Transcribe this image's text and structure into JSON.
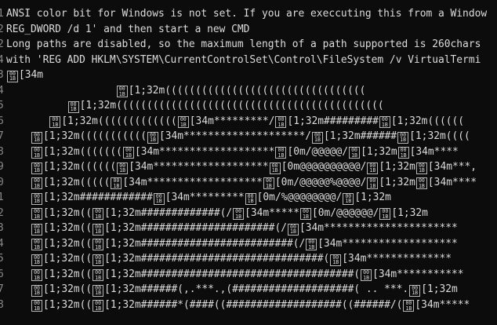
{
  "terminal": {
    "lines": [
      {
        "num": "1",
        "text": "ANSI color bit for Windows is not set. If you are execcuting this from a Window"
      },
      {
        "num": "2",
        "text": "REG_DWORD /d 1' and then start a new CMD"
      },
      {
        "num": "2",
        "text": "Long paths are disabled, so the maximum length of a path supported is 260chars"
      },
      {
        "num": "4",
        "text": "with 'REG ADD HKLM\\SYSTEM\\CurrentControlSet\\Control\\FileSystem /v VirtualTermi"
      },
      {
        "num": "3",
        "text": "\u001b[34m"
      },
      {
        "num": "4",
        "text": "                  \u001b[1;32m((((((((((((((((((((((((((((((((("
      },
      {
        "num": "5",
        "text": "          \u001b[1;32m(((((((((((((((((((((((((((((((((((((((((((("
      },
      {
        "num": "6",
        "text": "       \u001b[1;32m(((((((((((((\u001b[34m*********/\u001b[1;32m#########\u001b[1;32m(((((("
      },
      {
        "num": "7",
        "text": "    \u001b[1;32m(((((((((((\u001b[34m********************/\u001b[1;32m######\u001b[1;32m(((("
      },
      {
        "num": "8",
        "text": "    \u001b[1;32m(((((((\u001b[34m*******************\u001b[0m/@@@@@/\u001b[1;32m\u001b[34m****"
      },
      {
        "num": "9",
        "text": "    \u001b[1;32m((((((\u001b[34m*******************\u001b[0m@@@@@@@@@@/\u001b[1;32m\u001b[34m***,"
      },
      {
        "num": "0",
        "text": "    \u001b[1;32m(((((\u001b[34m*******************\u001b[0m/@@@@@%@@@@/\u001b[1;32m\u001b[34m****"
      },
      {
        "num": "1",
        "text": "    \u001b[1;32m############\u001b[34m*********\u001b[0m/%@@@@@@@@/\u001b[1;32m"
      },
      {
        "num": "2",
        "text": "    \u001b[1;32m((\u001b[1;32m#############(/\u001b[34m*****\u001b[0m/@@@@@@/\u001b[1;32m"
      },
      {
        "num": "3",
        "text": "    \u001b[1;32m((\u001b[1;32m######################(/\u001b[34m**********************"
      },
      {
        "num": "4",
        "text": "    \u001b[1;32m((\u001b[1;32m#########################(/\u001b[34m*******************"
      },
      {
        "num": "5",
        "text": "    \u001b[1;32m((\u001b[1;32m##############################(\u001b[34m**************"
      },
      {
        "num": "6",
        "text": "    \u001b[1;32m((\u001b[1;32m###################################(\u001b[34m***********"
      },
      {
        "num": "7",
        "text": "    \u001b[1;32m((\u001b[1;32m######(,.***.,(####################( .. ***.\u001b[1;32m"
      },
      {
        "num": "8",
        "text": "    \u001b[1;32m((\u001b[1;32m######*(####((###################((######/(\u001b[34m*****"
      }
    ],
    "escape_glyph": {
      "top": "00",
      "bottom": "1B"
    }
  }
}
